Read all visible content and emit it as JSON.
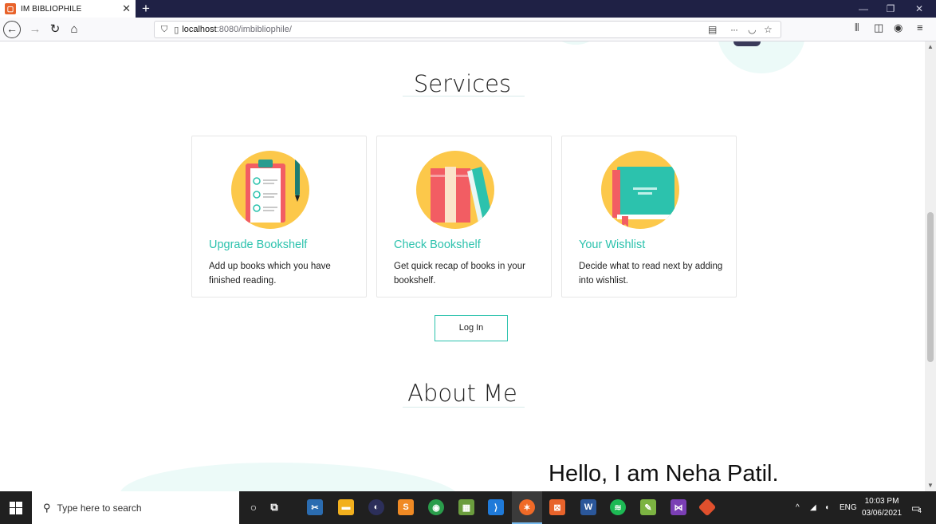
{
  "browser": {
    "tab_title": "IM BIBLIOPHILE",
    "tab_close": "✕",
    "new_tab": "+",
    "url_host": "localhost",
    "url_rest": ":8080/imbibliophile/",
    "menu_dots": "···"
  },
  "page": {
    "services_title": "Services",
    "cards": [
      {
        "title": "Upgrade Bookshelf",
        "desc": "Add up books which you have finished reading."
      },
      {
        "title": "Check Bookshelf",
        "desc": "Get quick recap of books in your bookshelf."
      },
      {
        "title": "Your Wishlist",
        "desc": "Decide what to read next by adding into wishlist."
      }
    ],
    "login_label": "Log In",
    "about_title": "About Me",
    "hello_text": "Hello, I am Neha Patil."
  },
  "taskbar": {
    "search_placeholder": "Type here to search",
    "language": "ENG",
    "time": "10:03 PM",
    "date": "03/06/2021",
    "notification_count": "4"
  },
  "colors": {
    "accent": "#2cc2ad",
    "icon_circle": "#fcc84a",
    "tab_bar": "#1f2145",
    "taskbar": "#202020"
  }
}
